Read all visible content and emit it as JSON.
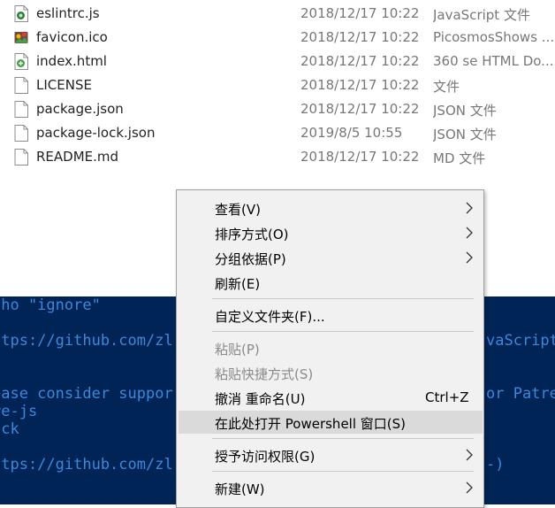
{
  "files": [
    {
      "name": "eslintrc.js",
      "date": "2018/12/17 10:22",
      "type": "JavaScript 文件",
      "icon": "js-file-icon"
    },
    {
      "name": "favicon.ico",
      "date": "2018/12/17 10:22",
      "type": "PicosmosShows ...",
      "icon": "image-file-icon"
    },
    {
      "name": "index.html",
      "date": "2018/12/17 10:22",
      "type": "360 se HTML Do...",
      "icon": "html-file-icon"
    },
    {
      "name": "LICENSE",
      "date": "2018/12/17 10:22",
      "type": "文件",
      "icon": "blank-file-icon"
    },
    {
      "name": "package.json",
      "date": "2018/12/17 10:22",
      "type": "JSON 文件",
      "icon": "blank-file-icon"
    },
    {
      "name": "package-lock.json",
      "date": "2019/8/5 10:55",
      "type": "JSON 文件",
      "icon": "blank-file-icon"
    },
    {
      "name": "README.md",
      "date": "2018/12/17 10:22",
      "type": "MD 文件",
      "icon": "blank-file-icon"
    }
  ],
  "console": {
    "left": [
      "cho \"ignore\"",
      "ttps://github.com/zl",
      "",
      "ease consider suppor",
      "re-js",
      "ock",
      "",
      "ttps://github.com/zl"
    ],
    "right_1": "vaScript",
    "right_2": "or Patre",
    "right_3": "-)",
    "bg_color": "#012456",
    "text_color": "#3e87d9"
  },
  "menu": {
    "view": "查看(V)",
    "sort": "排序方式(O)",
    "group": "分组依据(P)",
    "refresh": "刷新(E)",
    "customize": "自定义文件夹(F)...",
    "paste": "粘贴(P)",
    "paste_shortcut": "粘贴快捷方式(S)",
    "undo": "撤消 重命名(U)",
    "undo_shortcut": "Ctrl+Z",
    "open_powershell": "在此处打开 Powershell 窗口(S)",
    "grant_access": "授予访问权限(G)",
    "new": "新建(W)"
  }
}
